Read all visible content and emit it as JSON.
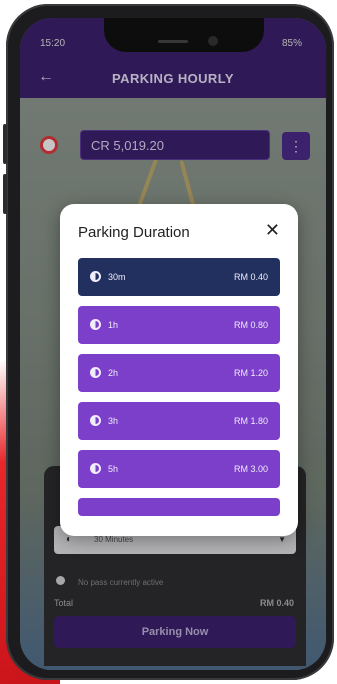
{
  "status_bar": {
    "time": "15:20",
    "battery": "85%"
  },
  "app_bar": {
    "title": "PARKING HOURLY"
  },
  "credit": {
    "balance": "CR 5,019.20"
  },
  "bottom_panel": {
    "duration_value": "30 Minutes",
    "pass_status": "No pass currently active",
    "total_label": "Total",
    "total_value": "RM 0.40",
    "parking_button": "Parking Now"
  },
  "dialog": {
    "title": "Parking Duration",
    "options": [
      {
        "label": "30m",
        "price": "RM 0.40",
        "selected": true
      },
      {
        "label": "1h",
        "price": "RM 0.80",
        "selected": false
      },
      {
        "label": "2h",
        "price": "RM 1.20",
        "selected": false
      },
      {
        "label": "3h",
        "price": "RM 1.80",
        "selected": false
      },
      {
        "label": "5h",
        "price": "RM 3.00",
        "selected": false
      }
    ]
  },
  "colors": {
    "brand_purple": "#3a1f6b",
    "option_purple": "#7b3fc9",
    "option_selected": "#21305f"
  }
}
